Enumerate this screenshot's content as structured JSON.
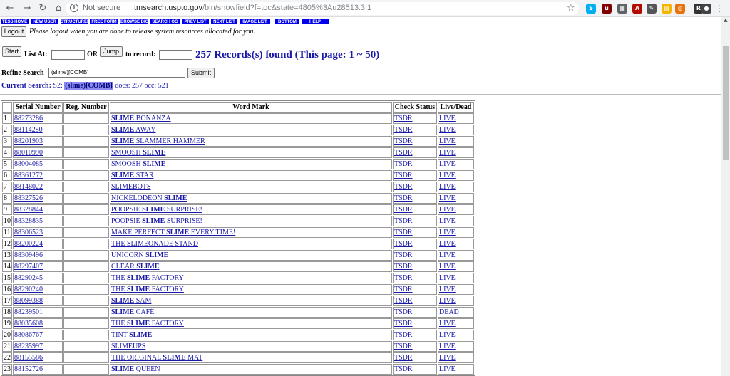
{
  "browser": {
    "security_text": "Not secure",
    "url_host": "tmsearch.uspto.gov",
    "url_path": "/bin/showfield?f=toc&state=4805%3Au28513.3.1",
    "extensions": [
      {
        "name": "skype-icon",
        "color": "#00aff0",
        "glyph": "S"
      },
      {
        "name": "ublock-icon",
        "color": "#800000",
        "glyph": "u"
      },
      {
        "name": "extension-icon",
        "color": "#5f6368",
        "glyph": "▦"
      },
      {
        "name": "pdf-icon",
        "color": "#b30b00",
        "glyph": "A"
      },
      {
        "name": "edit-icon",
        "color": "#555555",
        "glyph": "✎"
      },
      {
        "name": "notes-icon",
        "color": "#f4b400",
        "glyph": "▤"
      },
      {
        "name": "orange-extension-icon",
        "color": "#e8710a",
        "glyph": "◎"
      },
      {
        "name": "r-extension-icon",
        "color": "#333333",
        "glyph": "R"
      },
      {
        "name": "profile-avatar",
        "color": "#444444",
        "glyph": "●"
      },
      {
        "name": "red-extension-icon",
        "color": "#d93025",
        "glyph": "◆"
      }
    ]
  },
  "toolbar": [
    "TESS HOME",
    "NEW USER",
    "STRUCTURED",
    "FREE FORM",
    "BROWSE DICT",
    "SEARCH OG",
    "PREV LIST",
    "NEXT LIST",
    "IMAGE LIST",
    "BOTTOM",
    "HELP"
  ],
  "logout": {
    "button": "Logout",
    "message": "Please logout when you are done to release system resources allocated for you."
  },
  "nav": {
    "start_button": "Start",
    "list_at_label": "List At:",
    "list_at_value": "",
    "or_label": "OR",
    "jump_button": "Jump",
    "to_record_label": "to record:",
    "to_record_value": ""
  },
  "records_found": "257 Records(s) found (This page: 1 ~ 50)",
  "refine": {
    "label": "Refine Search",
    "value": "(slime)[COMB]",
    "submit": "Submit"
  },
  "current_search": {
    "label": "Current Search:",
    "set": "S2:",
    "term": "(slime)[COMB]",
    "stats": "docs: 257 occ: 521"
  },
  "table": {
    "headers": [
      "",
      "Serial Number",
      "Reg. Number",
      "Word Mark",
      "Check Status",
      "Live/Dead"
    ],
    "rows": [
      {
        "n": "1",
        "serial": "88273286",
        "reg": "",
        "mark": [
          [
            "SLIME",
            true
          ],
          [
            " BONANZA",
            false
          ]
        ],
        "status": "TSDR",
        "ld": "LIVE"
      },
      {
        "n": "2",
        "serial": "88114280",
        "reg": "",
        "mark": [
          [
            "SLIME",
            true
          ],
          [
            " AWAY",
            false
          ]
        ],
        "status": "TSDR",
        "ld": "LIVE"
      },
      {
        "n": "3",
        "serial": "88201903",
        "reg": "",
        "mark": [
          [
            "SLIME",
            true
          ],
          [
            " SLAMMER HAMMER",
            false
          ]
        ],
        "status": "TSDR",
        "ld": "LIVE"
      },
      {
        "n": "4",
        "serial": "88010990",
        "reg": "",
        "mark": [
          [
            "SMOOSH ",
            false
          ],
          [
            "SLIME",
            true
          ]
        ],
        "status": "TSDR",
        "ld": "LIVE"
      },
      {
        "n": "5",
        "serial": "88004085",
        "reg": "",
        "mark": [
          [
            "SMOOSH ",
            false
          ],
          [
            "SLIME",
            true
          ]
        ],
        "status": "TSDR",
        "ld": "LIVE"
      },
      {
        "n": "6",
        "serial": "88361272",
        "reg": "",
        "mark": [
          [
            "SLIME",
            true
          ],
          [
            " STAR",
            false
          ]
        ],
        "status": "TSDR",
        "ld": "LIVE"
      },
      {
        "n": "7",
        "serial": "88148022",
        "reg": "",
        "mark": [
          [
            "SLIMEBOTS",
            false
          ]
        ],
        "status": "TSDR",
        "ld": "LIVE"
      },
      {
        "n": "8",
        "serial": "88327526",
        "reg": "",
        "mark": [
          [
            "NICKELODEON ",
            false
          ],
          [
            "SLIME",
            true
          ]
        ],
        "status": "TSDR",
        "ld": "LIVE"
      },
      {
        "n": "9",
        "serial": "88328844",
        "reg": "",
        "mark": [
          [
            "POOPSIE ",
            false
          ],
          [
            "SLIME",
            true
          ],
          [
            " SURPRISE!",
            false
          ]
        ],
        "status": "TSDR",
        "ld": "LIVE"
      },
      {
        "n": "10",
        "serial": "88328835",
        "reg": "",
        "mark": [
          [
            "POOPSIE ",
            false
          ],
          [
            "SLIME",
            true
          ],
          [
            " SURPRISE!",
            false
          ]
        ],
        "status": "TSDR",
        "ld": "LIVE"
      },
      {
        "n": "11",
        "serial": "88306523",
        "reg": "",
        "mark": [
          [
            "MAKE PERFECT ",
            false
          ],
          [
            "SLIME",
            true
          ],
          [
            " EVERY TIME!",
            false
          ]
        ],
        "status": "TSDR",
        "ld": "LIVE"
      },
      {
        "n": "12",
        "serial": "88200224",
        "reg": "",
        "mark": [
          [
            "THE SLIMEONADE STAND",
            false
          ]
        ],
        "status": "TSDR",
        "ld": "LIVE"
      },
      {
        "n": "13",
        "serial": "88309496",
        "reg": "",
        "mark": [
          [
            "UNICORN ",
            false
          ],
          [
            "SLIME",
            true
          ]
        ],
        "status": "TSDR",
        "ld": "LIVE"
      },
      {
        "n": "14",
        "serial": "88297407",
        "reg": "",
        "mark": [
          [
            "CLEAR ",
            false
          ],
          [
            "SLIME",
            true
          ]
        ],
        "status": "TSDR",
        "ld": "LIVE"
      },
      {
        "n": "15",
        "serial": "88290245",
        "reg": "",
        "mark": [
          [
            "THE ",
            false
          ],
          [
            "SLIME",
            true
          ],
          [
            " FACTORY",
            false
          ]
        ],
        "status": "TSDR",
        "ld": "LIVE"
      },
      {
        "n": "16",
        "serial": "88290240",
        "reg": "",
        "mark": [
          [
            "THE ",
            false
          ],
          [
            "SLIME",
            true
          ],
          [
            " FACTORY",
            false
          ]
        ],
        "status": "TSDR",
        "ld": "LIVE"
      },
      {
        "n": "17",
        "serial": "88099388",
        "reg": "",
        "mark": [
          [
            "SLIME",
            true
          ],
          [
            " SAM",
            false
          ]
        ],
        "status": "TSDR",
        "ld": "LIVE"
      },
      {
        "n": "18",
        "serial": "88239501",
        "reg": "",
        "mark": [
          [
            "SLIME",
            true
          ],
          [
            " CAFÉ",
            false
          ]
        ],
        "status": "TSDR",
        "ld": "DEAD"
      },
      {
        "n": "19",
        "serial": "88035608",
        "reg": "",
        "mark": [
          [
            "THE ",
            false
          ],
          [
            "SLIME",
            true
          ],
          [
            " FACTORY",
            false
          ]
        ],
        "status": "TSDR",
        "ld": "LIVE"
      },
      {
        "n": "20",
        "serial": "88086767",
        "reg": "",
        "mark": [
          [
            "TINT ",
            false
          ],
          [
            "SLIME",
            true
          ]
        ],
        "status": "TSDR",
        "ld": "LIVE"
      },
      {
        "n": "21",
        "serial": "88235997",
        "reg": "",
        "mark": [
          [
            "SLIMEUPS",
            false
          ]
        ],
        "status": "TSDR",
        "ld": "LIVE"
      },
      {
        "n": "22",
        "serial": "88155586",
        "reg": "",
        "mark": [
          [
            "THE ORIGINAL ",
            false
          ],
          [
            "SLIME",
            true
          ],
          [
            " MAT",
            false
          ]
        ],
        "status": "TSDR",
        "ld": "LIVE"
      },
      {
        "n": "23",
        "serial": "88152726",
        "reg": "",
        "mark": [
          [
            "SLIME",
            true
          ],
          [
            " QUEEN",
            false
          ]
        ],
        "status": "TSDR",
        "ld": "LIVE"
      }
    ]
  }
}
